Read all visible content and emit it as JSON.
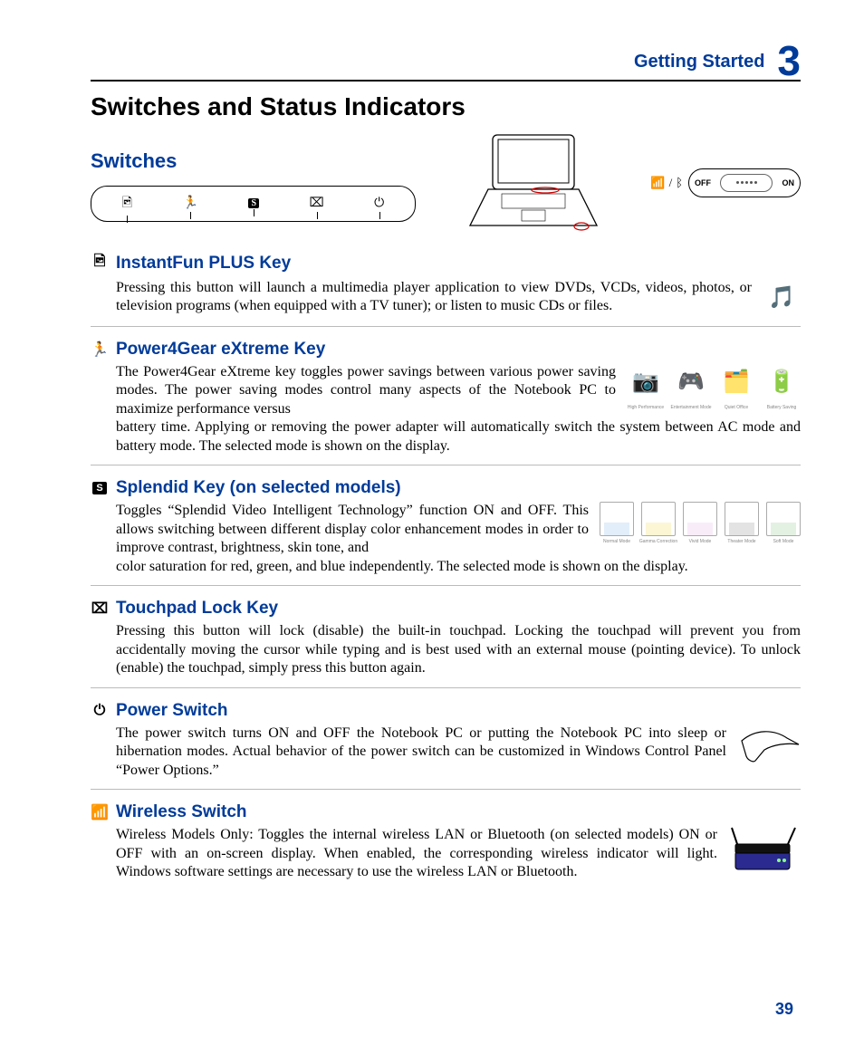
{
  "header": {
    "section": "Getting Started",
    "chapter": "3"
  },
  "titles": {
    "main": "Switches and Status Indicators",
    "sub": "Switches"
  },
  "wireless_switch_labels": {
    "off": "OFF",
    "on": "ON"
  },
  "items": [
    {
      "icon": "🖻",
      "title": "InstantFun PLUS Key",
      "body_first": "Pressing this button will launch a multimedia player application to view DVDs, VCDs, videos, photos, or television programs (when equipped with a TV tuner); or listen to music CDs or files.",
      "body_after": "",
      "graphic": "media",
      "thumb_captions": []
    },
    {
      "icon": "🏃",
      "title": "Power4Gear eXtreme Key",
      "body_first": "The Power4Gear eXtreme key toggles power savings between various power saving modes. The power saving modes control many aspects of the Notebook PC to maximize performance versus",
      "body_after": "battery time. Applying or removing the power adapter will automatically switch the system between AC mode and battery mode. The selected mode is shown on the display.",
      "graphic": "power4gear",
      "thumb_captions": [
        "High Performance",
        "Entertainment Mode",
        "Quiet Office",
        "Battery Saving"
      ]
    },
    {
      "icon": "S",
      "title": "Splendid Key (on selected models)",
      "body_first": "Toggles “Splendid Video Intelligent Technology” function ON and OFF. This allows switching between different display color enhancement modes in order to improve contrast, brightness, skin tone, and",
      "body_after": "color saturation for red, green, and blue independently. The selected mode is shown on the display.",
      "graphic": "splendid",
      "thumb_captions": [
        "Normal Mode",
        "Gamma Correction",
        "Vivid Mode",
        "Theater Mode",
        "Soft Mode"
      ]
    },
    {
      "icon": "⌧",
      "title": "Touchpad Lock Key",
      "body_first": "Pressing this button will lock (disable) the built-in touchpad. Locking the touchpad will prevent you from accidentally moving the cursor while typing and is best used with an external mouse (pointing device). To unlock (enable) the touchpad, simply press this button again.",
      "body_after": "",
      "graphic": null,
      "thumb_captions": []
    },
    {
      "icon": "⏻",
      "title": "Power Switch",
      "body_first": "The power switch turns ON and OFF the Notebook PC or putting the Notebook PC into sleep or hibernation modes. Actual behavior of the power switch can be customized in Windows Control Panel “Power Options.”",
      "body_after": "",
      "graphic": "hand",
      "thumb_captions": []
    },
    {
      "icon": "📶",
      "title": "Wireless Switch",
      "body_first": "Wireless Models Only: Toggles the internal wireless LAN or Bluetooth (on selected models) ON or OFF with an on-screen display. When enabled, the corresponding wireless indicator will light. Windows software settings are necessary to use the wireless LAN or Bluetooth.",
      "body_after": "",
      "graphic": "router",
      "thumb_captions": []
    }
  ],
  "page_number": "39"
}
